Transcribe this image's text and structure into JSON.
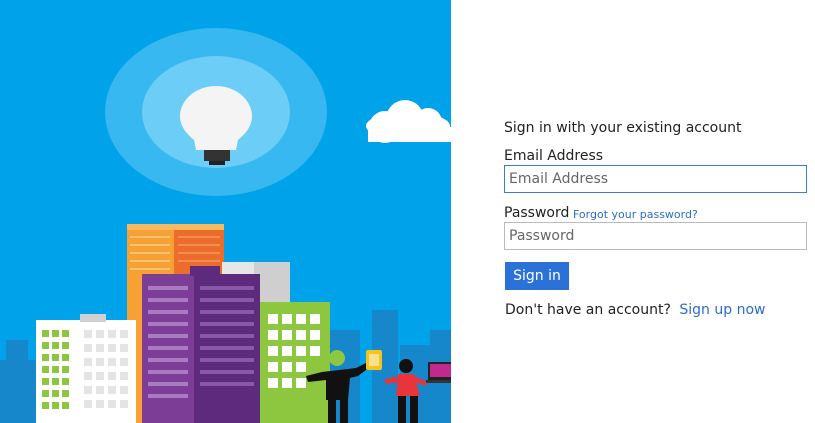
{
  "colors": {
    "hero_bg": "#00a2ea",
    "accent": "#2b72d8",
    "link": "#2b6ec6"
  },
  "hero": {
    "icons": [
      "lightbulb-icon",
      "cloud-icon"
    ]
  },
  "form": {
    "heading": "Sign in with your existing account",
    "email": {
      "label": "Email Address",
      "placeholder": "Email Address",
      "value": ""
    },
    "password": {
      "label": "Password",
      "placeholder": "Password",
      "value": ""
    },
    "forgot_link": "Forgot your password?",
    "sign_in_label": "Sign in",
    "no_account_text": "Don't have an account?",
    "sign_up_link": "Sign up now"
  }
}
